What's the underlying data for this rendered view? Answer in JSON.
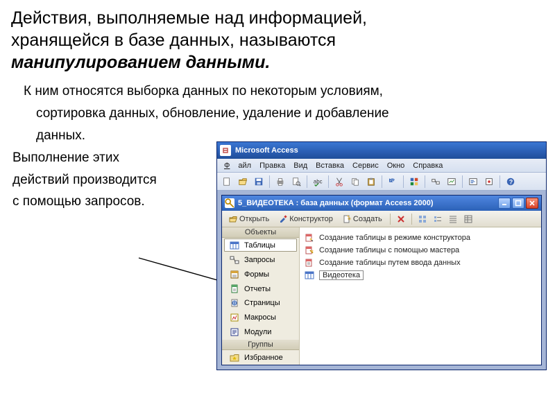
{
  "heading": {
    "line1": "Действия, выполняемые над информацией,",
    "line2": "хранящейся в базе данных, называются",
    "emph": "манипулированием данными."
  },
  "body": {
    "p1a": "К ним относятся выборка данных по некоторым условиям,",
    "p1b": "сортировка данных, обновление, удаление и добавление",
    "p1c": "данных.",
    "p2": "Выполнение этих",
    "p3": "действий производится",
    "p4": "с помощью запросов."
  },
  "access": {
    "app_title": "Microsoft Access",
    "menu": {
      "file": "Файл",
      "edit": "Правка",
      "view": "Вид",
      "insert": "Вставка",
      "service": "Сервис",
      "window": "Окно",
      "help": "Справка"
    },
    "db_title": "5_ВИДЕОТЕКА : база данных (формат Access 2000)",
    "dbtb": {
      "open": "Открыть",
      "design": "Конструктор",
      "create": "Создать"
    },
    "nav": {
      "hdr1": "Объекты",
      "tables": "Таблицы",
      "queries": "Запросы",
      "forms": "Формы",
      "reports": "Отчеты",
      "pages": "Страницы",
      "macros": "Макросы",
      "modules": "Модули",
      "hdr2": "Группы",
      "fav": "Избранное"
    },
    "list": {
      "i1": "Создание таблицы в режиме конструктора",
      "i2": "Создание таблицы с помощью мастера",
      "i3": "Создание таблицы путем ввода данных",
      "i4": "Видеотека"
    }
  }
}
